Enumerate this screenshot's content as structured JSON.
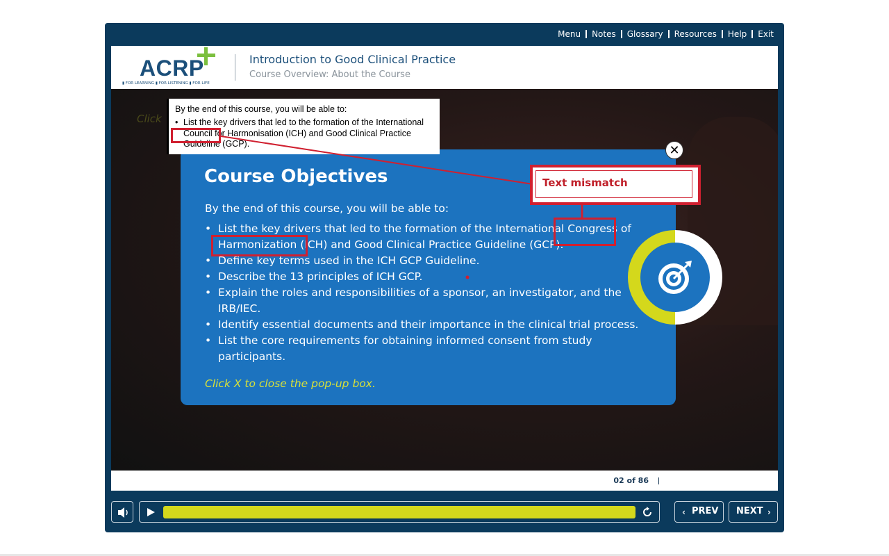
{
  "top_nav": [
    "Menu",
    "Notes",
    "Glossary",
    "Resources",
    "Help",
    "Exit"
  ],
  "logo": {
    "text": "ACRP",
    "tagline": "▮ FOR LEARNING ▮ FOR LISTENING ▮ FOR LIFE"
  },
  "header": {
    "title": "Introduction to Good Clinical Practice",
    "subtitle": "Course Overview: About the Course"
  },
  "background": {
    "hint_fragment": "Click"
  },
  "popup": {
    "title": "Course Objectives",
    "intro": "By the end of this course, you will be able to:",
    "objectives": [
      "List the key drivers that led to the formation of the International Congress of Harmonization (ICH) and Good Clinical Practice Guideline (GCP).",
      "Define key terms used in the ICH GCP Guideline.",
      "Describe the 13 principles of ICH GCP.",
      "Explain the roles and responsibilities of a sponsor, an investigator, and the IRB/IEC.",
      "Identify essential documents and their importance in the clinical trial process.",
      "List the core requirements for obtaining informed consent from study participants."
    ],
    "hint": "Click X to close the pop-up box.",
    "close_symbol": "✕"
  },
  "reference_snippet": {
    "intro": "By the end of this course, you will be able to:",
    "item": "List the key drivers that led to the formation of the International Council for Harmonisation (ICH) and Good Clinical Practice Guideline (GCP)."
  },
  "annotation": {
    "label": "Text mismatch",
    "color": "#d02030"
  },
  "footer": {
    "page_counter": "02 of 86"
  },
  "controls": {
    "prev_label": "PREV",
    "next_label": "NEXT",
    "progress_fraction": 1.0
  },
  "colors": {
    "player_frame": "#0b3a5c",
    "popup_bg": "#1c73bf",
    "accent_yellow": "#d4d81c",
    "logo_green": "#7bbf3e"
  }
}
